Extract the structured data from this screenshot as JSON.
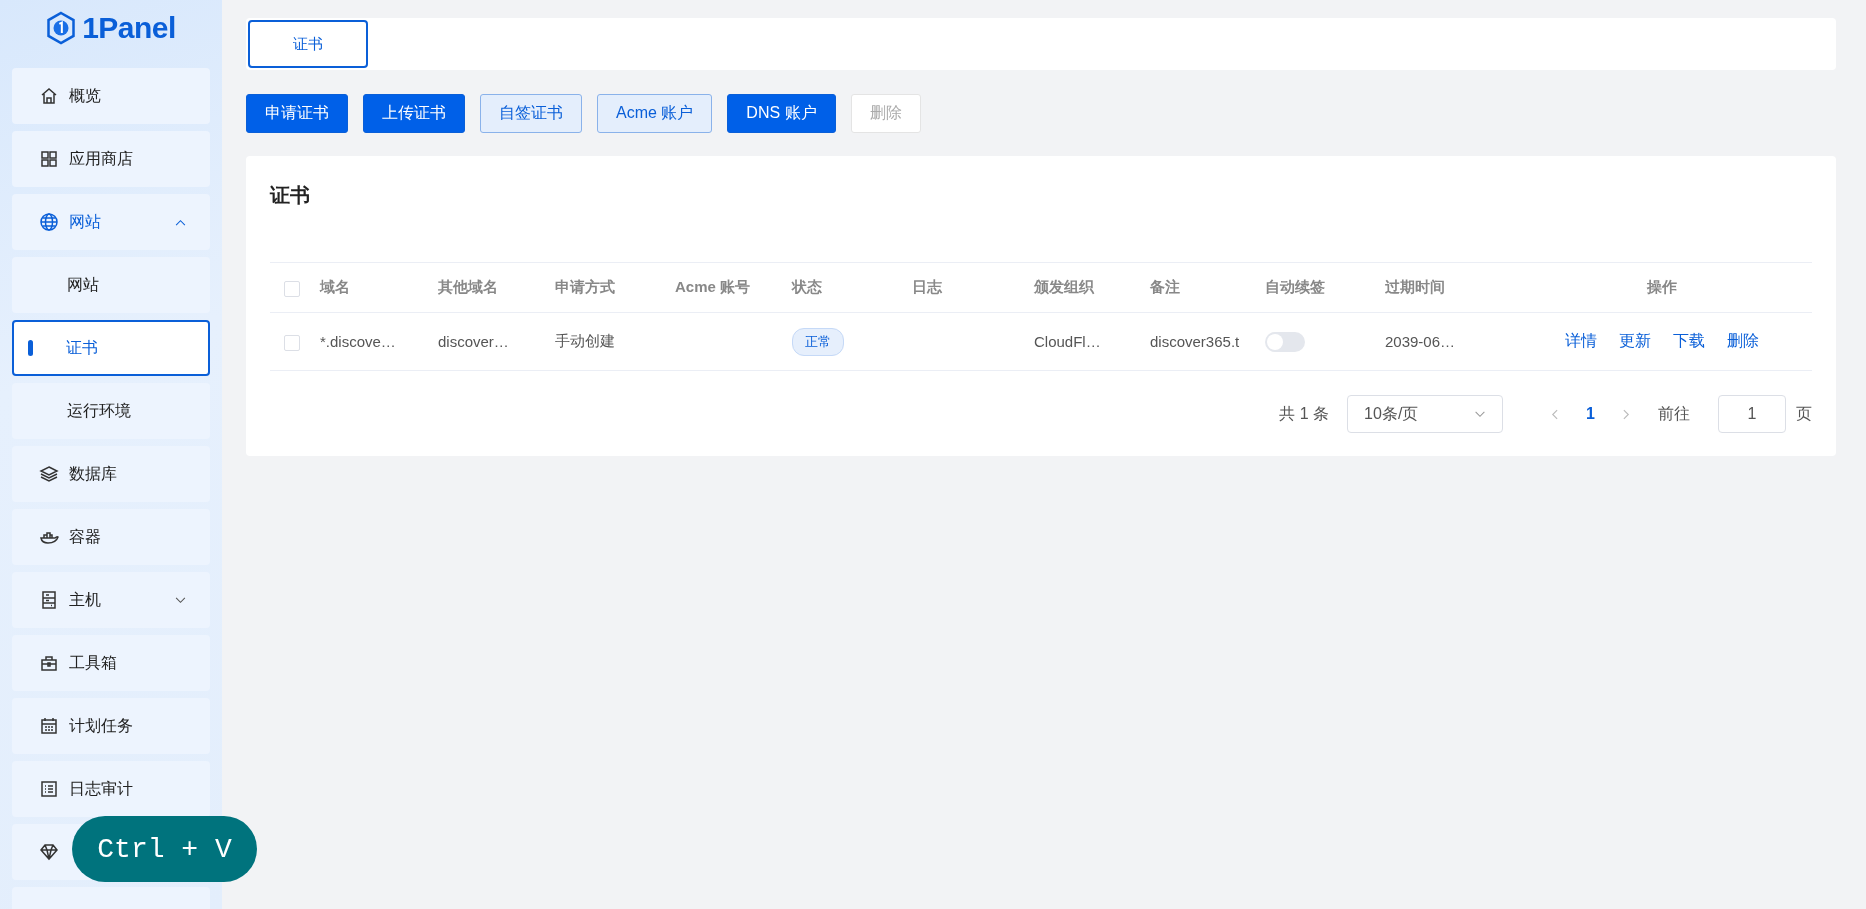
{
  "sidebar": {
    "logo": "1Panel",
    "items": [
      {
        "label": "概览",
        "selected": false
      },
      {
        "label": "应用商店",
        "selected": false
      },
      {
        "label": "网站",
        "selected": false,
        "expanded": true,
        "children": [
          {
            "label": "网站",
            "selected": false
          },
          {
            "label": "证书",
            "selected": true
          },
          {
            "label": "运行环境",
            "selected": false
          }
        ]
      },
      {
        "label": "数据库",
        "selected": false
      },
      {
        "label": "容器",
        "selected": false
      },
      {
        "label": "主机",
        "selected": false,
        "expanded": false
      },
      {
        "label": "工具箱",
        "selected": false
      },
      {
        "label": "计划任务",
        "selected": false
      },
      {
        "label": "日志审计",
        "selected": false
      },
      {
        "selected": false
      }
    ]
  },
  "tabs": [
    {
      "label": "证书",
      "selected": true
    }
  ],
  "toolbar": [
    {
      "label": "申请证书",
      "kind": "primary",
      "disabled": false
    },
    {
      "label": "上传证书",
      "kind": "primary",
      "disabled": false
    },
    {
      "label": "自签证书",
      "kind": "plain",
      "disabled": false
    },
    {
      "label": "Acme 账户",
      "kind": "plain",
      "disabled": false
    },
    {
      "label": "DNS 账户",
      "kind": "primary",
      "disabled": false
    },
    {
      "label": "删除",
      "kind": "plain",
      "disabled": true
    }
  ],
  "card": {
    "title": "证书",
    "table": {
      "select_all_checked": false,
      "columns": [
        "域名",
        "其他域名",
        "申请方式",
        "Acme 账号",
        "状态",
        "日志",
        "颁发组织",
        "备注",
        "自动续签",
        "过期时间",
        "操作"
      ],
      "rows": [
        {
          "checked": false,
          "domain": "*.discove…",
          "other_domains": "discover…",
          "method": "手动创建",
          "status": "正常",
          "issuer": "CloudFl…",
          "remark": "discover365.t",
          "auto_renew": false,
          "expires": "2039-06…",
          "actions": [
            "详情",
            "更新",
            "下载",
            "删除"
          ]
        }
      ]
    },
    "pagination": {
      "total": "共 1 条",
      "page_size": "10条/页",
      "pages": [
        {
          "label": "1",
          "selected": true
        }
      ],
      "goto_label": "前往",
      "goto_value": "1",
      "page_unit": "页"
    }
  },
  "key_overlay": "Ctrl + V"
}
